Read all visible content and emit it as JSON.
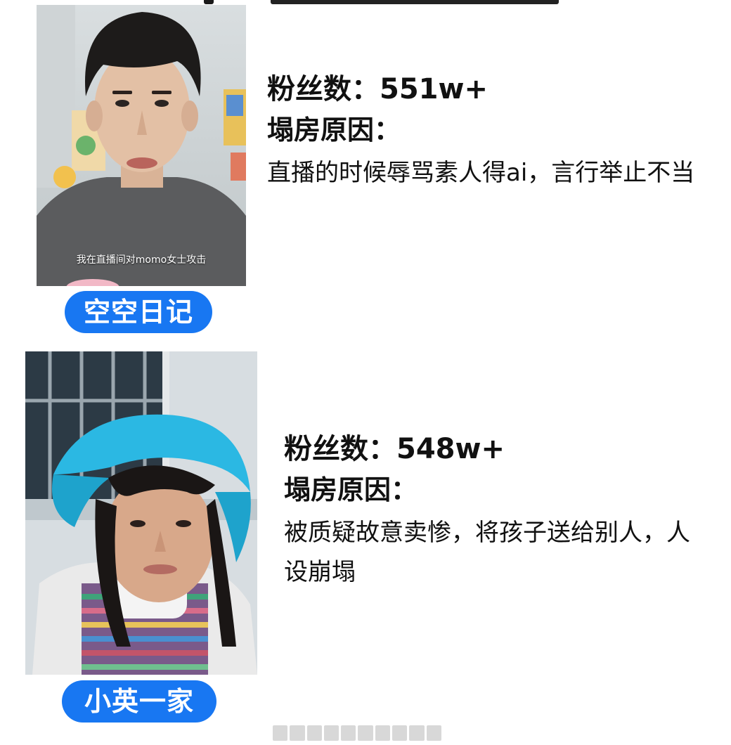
{
  "entries": [
    {
      "fans_label": "粉丝数：",
      "fans_value": "551w+",
      "reason_label": "塌房原因：",
      "reason_text": "直播的时候辱骂素人得ai，言行举止不当",
      "name": "空空日记",
      "photo_caption": "我在直播间对momo女士攻击"
    },
    {
      "fans_label": "粉丝数：",
      "fans_value": "548w+",
      "reason_label": "塌房原因：",
      "reason_text": "被质疑故意卖惨，将孩子送给别人，人设崩塌",
      "name": "小英一家",
      "photo_caption": ""
    }
  ],
  "colors": {
    "pill_blue": "#1877f2",
    "text": "#111111",
    "background": "#ffffff"
  }
}
